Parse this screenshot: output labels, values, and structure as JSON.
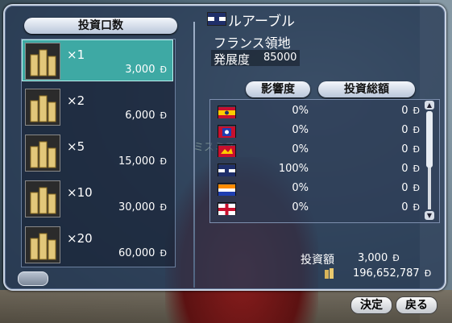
{
  "dialog": {
    "units_header": "投資口数",
    "influence_header": "影響度",
    "total_header": "投資総額",
    "currency_symbol": "Ð"
  },
  "city": {
    "name": "ルアーブル",
    "territory": "フランス領地",
    "development_label": "発展度",
    "development_value": "85000"
  },
  "investment_units": [
    {
      "multiplier": "×1",
      "price": "3,000",
      "selected": true
    },
    {
      "multiplier": "×2",
      "price": "6,000",
      "selected": false
    },
    {
      "multiplier": "×5",
      "price": "15,000",
      "selected": false
    },
    {
      "multiplier": "×10",
      "price": "30,000",
      "selected": false
    },
    {
      "multiplier": "×20",
      "price": "60,000",
      "selected": false
    }
  ],
  "nations": [
    {
      "flag": "portugal-flag-icon",
      "influence": "0%",
      "amount": "0"
    },
    {
      "flag": "netherlands-flag-icon",
      "influence": "0%",
      "amount": "0"
    },
    {
      "flag": "spain-flag-icon",
      "influence": "0%",
      "amount": "0"
    },
    {
      "flag": "france-flag-icon",
      "influence": "100%",
      "amount": "0"
    },
    {
      "flag": "venice-flag-icon",
      "influence": "0%",
      "amount": "0"
    },
    {
      "flag": "england-flag-icon",
      "influence": "0%",
      "amount": "0"
    }
  ],
  "summary": {
    "investment_label": "投資額",
    "investment_value": "3,000",
    "gold_value": "196,652,787"
  },
  "buttons": {
    "confirm": "決定",
    "back": "戻る"
  },
  "background": {
    "name_tag": "ミスミス"
  },
  "colors": {
    "selected_row": "#3ea9a4",
    "panel_bg": "#283a55"
  }
}
